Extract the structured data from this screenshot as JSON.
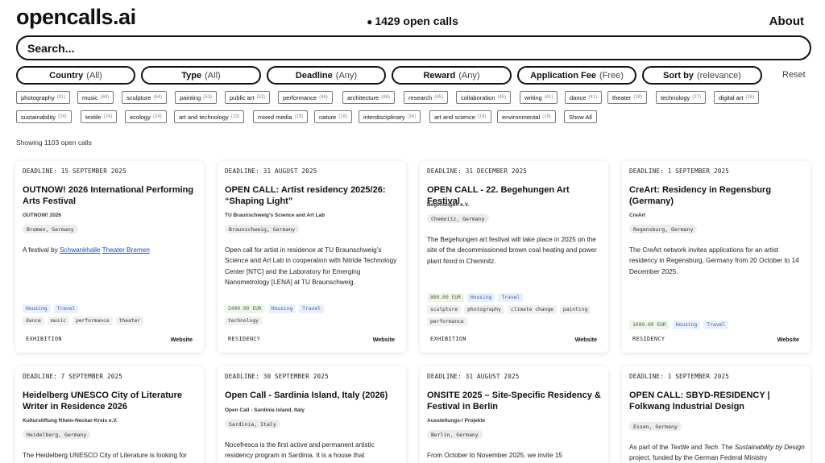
{
  "header": {
    "logo": "opencalls.ai",
    "open_count": "1429 open calls",
    "about_label": "About"
  },
  "search": {
    "placeholder": "Search..."
  },
  "filters": [
    {
      "label": "Country",
      "value": "(All)"
    },
    {
      "label": "Type",
      "value": "(All)"
    },
    {
      "label": "Deadline",
      "value": "(Any)"
    },
    {
      "label": "Reward",
      "value": "(Any)"
    },
    {
      "label": "Application Fee",
      "value": "(Free)"
    },
    {
      "label": "Sort by",
      "value": "(relevance)"
    }
  ],
  "reset_label": "Reset",
  "tag_rows": [
    [
      {
        "name": "photography",
        "count": "(81)"
      },
      {
        "name": "music",
        "count": "(69)"
      },
      {
        "name": "sculpture",
        "count": "(64)"
      },
      {
        "name": "painting",
        "count": "(53)"
      },
      {
        "name": "public art",
        "count": "(53)"
      },
      {
        "name": "performance",
        "count": "(46)"
      },
      {
        "name": "architecture",
        "count": "(46)"
      },
      {
        "name": "research",
        "count": "(45)"
      },
      {
        "name": "collaboration",
        "count": "(45)"
      },
      {
        "name": "writing",
        "count": "(41)"
      },
      {
        "name": "dance",
        "count": "(41)"
      },
      {
        "name": "theater",
        "count": "(28)"
      },
      {
        "name": "technology",
        "count": "(27)"
      },
      {
        "name": "digital art",
        "count": "(26)"
      }
    ],
    [
      {
        "name": "sustainability",
        "count": "(24)"
      },
      {
        "name": "textile",
        "count": "(24)"
      },
      {
        "name": "ecology",
        "count": "(24)"
      },
      {
        "name": "art and technology",
        "count": "(23)"
      },
      {
        "name": "mixed media",
        "count": "(19)"
      },
      {
        "name": "nature",
        "count": "(18)"
      },
      {
        "name": "interdisciplinary",
        "count": "(16)"
      },
      {
        "name": "art and science",
        "count": "(16)"
      },
      {
        "name": "environmental",
        "count": "(16)"
      },
      {
        "name": "Show All",
        "count": ""
      }
    ]
  ],
  "showing": "Showing 1103 open calls",
  "cards": [
    {
      "deadline": "DEADLINE: 15 SEPTEMBER 2025",
      "title": "OUTNOW! 2026 International Performing Arts Festival",
      "org": "OUTNOW! 2026",
      "location": "Bremen, Germany",
      "desc_prefix": "A festival by ",
      "desc_links": [
        "Schwankhalle",
        "Theater Bremen"
      ],
      "description": "",
      "reward": "",
      "benefits": [
        "Housing",
        "Travel"
      ],
      "disciplines": [
        "dance",
        "music",
        "performance",
        "theater"
      ],
      "type": "EXHIBITION",
      "website": "Website"
    },
    {
      "deadline": "DEADLINE: 31 AUGUST 2025",
      "title": "OPEN CALL: Artist residency 2025/26: “Shaping Light”",
      "org": "TU Braunschweig’s Science and Art Lab",
      "location": "Braunschweig, Germany",
      "description": "Open call for artist in residence at TU Braunschweig’s Science and Art Lab in cooperation with Nitride Technology Center [NTC] and the Laboratory for Emerging Nanometrology [LENA] at TU Braunschweig.",
      "reward": "2400.00 EUR",
      "benefits": [
        "Housing",
        "Travel"
      ],
      "disciplines": [
        "technology"
      ],
      "type": "RESIDENCY",
      "website": "Website"
    },
    {
      "deadline": "DEADLINE: 31 DECEMBER 2025",
      "title": "OPEN CALL - 22. Begehungen Art Festival",
      "org": "Begehungen e.V.",
      "location": "Chemnitz, Germany",
      "description": "The Begehungen art festival will take place in 2025 on the site of the decommissioned brown coal heating and power plant Nord in Chemnitz.",
      "reward": "800.00 EUR",
      "benefits": [
        "Housing",
        "Travel"
      ],
      "disciplines": [
        "sculpture",
        "photography",
        "climate change",
        "painting",
        "performance"
      ],
      "type": "EXHIBITION",
      "website": "Website"
    },
    {
      "deadline": "DEADLINE: 1 SEPTEMBER 2025",
      "title": "CreArt: Residency in Regensburg (Germany)",
      "org": "CreArt",
      "location": "Regensburg, Germany",
      "description": "The CreArt network invites applications for an artist residency in Regensburg, Germany from 20 October to 14 December 2025.",
      "reward": "1000.00 EUR",
      "benefits": [
        "Housing",
        "Travel"
      ],
      "disciplines": [],
      "type": "RESIDENCY",
      "website": "Website"
    },
    {
      "deadline": "DEADLINE: 7 SEPTEMBER 2025",
      "title": "Heidelberg UNESCO City of Literature Writer in Residence 2026",
      "org": "Kulturstiftung Rhein-Neckar-Kreis e.V.",
      "location": "Heidelberg, Germany",
      "description": "The Heidelberg UNESCO City of Literature is looking for"
    },
    {
      "deadline": "DEADLINE: 30 SEPTEMBER 2025",
      "title": "Open Call - Sardinia Island, Italy (2026)",
      "org": "Open Call - Sardinia Island, Italy",
      "location": "Sardinia, Italy",
      "description": "Nocefresca is the first active and permanent artistic residency program in Sardinia. It is a house that"
    },
    {
      "deadline": "DEADLINE: 31 AUGUST 2025",
      "title": "ONSITE 2025 – Site-Specific Residency & Festival in Berlin",
      "org": "Ausstellungs-/ Projekte",
      "location": "Berlin, Germany",
      "description": "From October to November 2025, we invite 15"
    },
    {
      "deadline": "DEADLINE: 1 SEPTEMBER 2025",
      "title": "OPEN CALL: SBYD-RESIDENCY | Folkwang Industrial Design",
      "org": "",
      "location": "Essen, Germany",
      "desc_parts": [
        "As part of the ",
        "Textile",
        " and ",
        "Tech",
        ". The ",
        "Sustainability by Design",
        " project, funded by the German Federal Ministry"
      ]
    }
  ]
}
